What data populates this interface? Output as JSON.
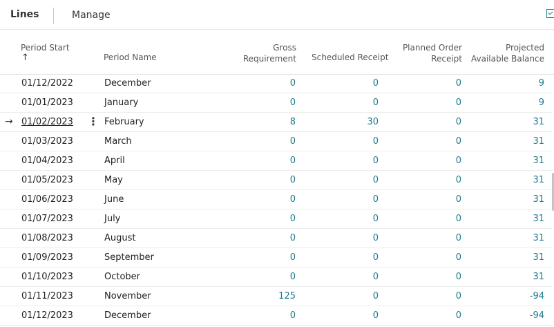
{
  "toolbar": {
    "lines_label": "Lines",
    "manage_label": "Manage"
  },
  "columns": {
    "period_start": "Period Start",
    "period_name": "Period Name",
    "gross_requirement": [
      "Gross",
      "Requirement"
    ],
    "scheduled_receipt": "Scheduled Receipt",
    "planned_order_receipt": [
      "Planned Order",
      "Receipt"
    ],
    "projected_available_balance": [
      "Projected",
      "Available Balance"
    ]
  },
  "sort_indicator": "↑",
  "rows": [
    {
      "start": "01/12/2022",
      "name": "December",
      "gross": "0",
      "sched": "0",
      "planned": "0",
      "proj": "9"
    },
    {
      "start": "01/01/2023",
      "name": "January",
      "gross": "0",
      "sched": "0",
      "planned": "0",
      "proj": "9"
    },
    {
      "start": "01/02/2023",
      "name": "February",
      "gross": "8",
      "sched": "30",
      "planned": "0",
      "proj": "31",
      "selected": true
    },
    {
      "start": "01/03/2023",
      "name": "March",
      "gross": "0",
      "sched": "0",
      "planned": "0",
      "proj": "31"
    },
    {
      "start": "01/04/2023",
      "name": "April",
      "gross": "0",
      "sched": "0",
      "planned": "0",
      "proj": "31"
    },
    {
      "start": "01/05/2023",
      "name": "May",
      "gross": "0",
      "sched": "0",
      "planned": "0",
      "proj": "31"
    },
    {
      "start": "01/06/2023",
      "name": "June",
      "gross": "0",
      "sched": "0",
      "planned": "0",
      "proj": "31"
    },
    {
      "start": "01/07/2023",
      "name": "July",
      "gross": "0",
      "sched": "0",
      "planned": "0",
      "proj": "31"
    },
    {
      "start": "01/08/2023",
      "name": "August",
      "gross": "0",
      "sched": "0",
      "planned": "0",
      "proj": "31"
    },
    {
      "start": "01/09/2023",
      "name": "September",
      "gross": "0",
      "sched": "0",
      "planned": "0",
      "proj": "31"
    },
    {
      "start": "01/10/2023",
      "name": "October",
      "gross": "0",
      "sched": "0",
      "planned": "0",
      "proj": "31"
    },
    {
      "start": "01/11/2023",
      "name": "November",
      "gross": "125",
      "sched": "0",
      "planned": "0",
      "proj": "-94"
    },
    {
      "start": "01/12/2023",
      "name": "December",
      "gross": "0",
      "sched": "0",
      "planned": "0",
      "proj": "-94"
    }
  ],
  "colors": {
    "accent": "#1c7a8c"
  }
}
